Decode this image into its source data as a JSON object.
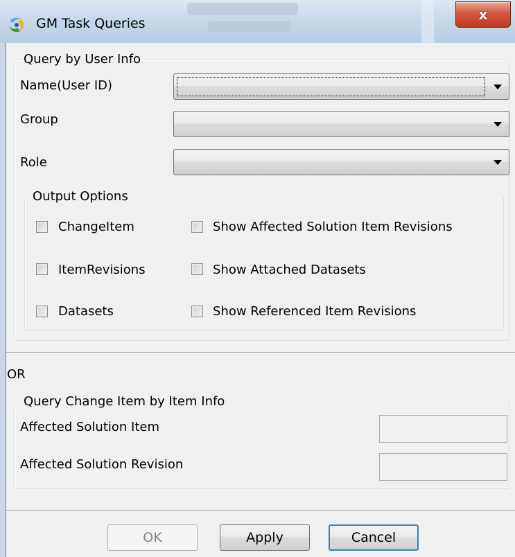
{
  "window": {
    "title": "GM Task Queries",
    "close_glyph": "x",
    "icon": "swirl-app-icon"
  },
  "user_info": {
    "legend": "Query by User Info",
    "fields": [
      {
        "label": "Name(User ID)",
        "value": ""
      },
      {
        "label": "Group",
        "value": ""
      },
      {
        "label": "Role",
        "value": ""
      }
    ]
  },
  "output_options": {
    "legend": "Output Options",
    "checkboxes": [
      {
        "label": "ChangeItem",
        "checked": false
      },
      {
        "label": "ItemRevisions",
        "checked": false
      },
      {
        "label": "Datasets",
        "checked": false
      },
      {
        "label": "Show Affected Solution Item Revisions",
        "checked": false
      },
      {
        "label": "Show Attached Datasets",
        "checked": false
      },
      {
        "label": "Show Referenced Item Revisions",
        "checked": false
      }
    ]
  },
  "or_label": "OR",
  "item_info": {
    "legend": "Query Change Item by Item Info",
    "fields": [
      {
        "label": "Affected Solution Item",
        "value": ""
      },
      {
        "label": "Affected Solution Revision",
        "value": ""
      }
    ]
  },
  "buttons": {
    "ok": "OK",
    "apply": "Apply",
    "cancel": "Cancel"
  }
}
